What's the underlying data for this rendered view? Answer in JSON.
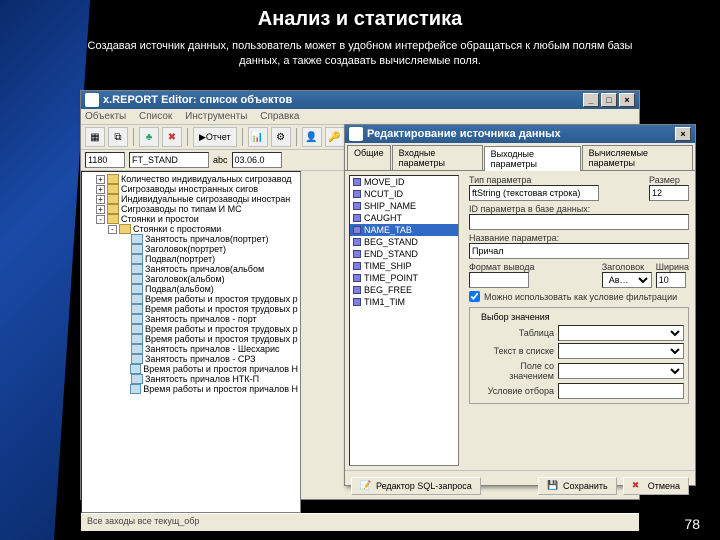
{
  "slide": {
    "title": "Анализ и статистика",
    "subtitle": "Создавая источник данных, пользователь может в удобном интерфейсе обращаться к любым полям базы данных, а также создавать вычисляемые поля.",
    "page_number": "78"
  },
  "editor": {
    "title": "x.REPORT Editor: список объектов",
    "menu": [
      "Объекты",
      "Список",
      "Инструменты",
      "Справка"
    ],
    "toolbar": {
      "report_label": "Отчет"
    },
    "subbar": {
      "code": "1180",
      "table": "FT_STAND",
      "date": "03.06.0"
    },
    "tree": [
      {
        "lvl": 1,
        "tg": "+",
        "icon": "f",
        "label": "Количество индивидуальных сигрозавод"
      },
      {
        "lvl": 1,
        "tg": "+",
        "icon": "f",
        "label": "Сигрозаводы иностранных сигов"
      },
      {
        "lvl": 1,
        "tg": "+",
        "icon": "f",
        "label": "Индивидуальные сигрозаводы иностран"
      },
      {
        "lvl": 1,
        "tg": "+",
        "icon": "f",
        "label": "Сигрозаводы по типам И МС"
      },
      {
        "lvl": 1,
        "tg": "-",
        "icon": "f",
        "label": "Стоянки и простои"
      },
      {
        "lvl": 2,
        "tg": "-",
        "icon": "f",
        "label": "Стоянки с простоями"
      },
      {
        "lvl": 3,
        "tg": "",
        "icon": "g",
        "label": "Занятость причалов(портрет)"
      },
      {
        "lvl": 3,
        "tg": "",
        "icon": "g",
        "label": "Заголовок(портрет)"
      },
      {
        "lvl": 3,
        "tg": "",
        "icon": "g",
        "label": "Подвал(портрет)"
      },
      {
        "lvl": 3,
        "tg": "",
        "icon": "g",
        "label": "Занятость причалов(альбом"
      },
      {
        "lvl": 3,
        "tg": "",
        "icon": "g",
        "label": "Заголовок(альбом)"
      },
      {
        "lvl": 3,
        "tg": "",
        "icon": "g",
        "label": "Подвал(альбом)"
      },
      {
        "lvl": 3,
        "tg": "",
        "icon": "g",
        "label": "Время работы и простоя трудовых р"
      },
      {
        "lvl": 3,
        "tg": "",
        "icon": "g",
        "label": "Время работы и простоя трудовых р"
      },
      {
        "lvl": 3,
        "tg": "",
        "icon": "g",
        "label": "Занятость причалов - порт"
      },
      {
        "lvl": 3,
        "tg": "",
        "icon": "g",
        "label": "Время работы и простоя трудовых р"
      },
      {
        "lvl": 3,
        "tg": "",
        "icon": "g",
        "label": "Время работы и простоя трудовых р"
      },
      {
        "lvl": 3,
        "tg": "",
        "icon": "g",
        "label": "Занятость причалов - Шесхарис"
      },
      {
        "lvl": 3,
        "tg": "",
        "icon": "g",
        "label": "Занятость причалов - СРЗ"
      },
      {
        "lvl": 3,
        "tg": "",
        "icon": "g",
        "label": "Время работы и простоя причалов Н"
      },
      {
        "lvl": 3,
        "tg": "",
        "icon": "g",
        "label": "Занятость причалов НТК-П"
      },
      {
        "lvl": 3,
        "tg": "",
        "icon": "g",
        "label": "Время работы и простоя причалов Н"
      }
    ],
    "statusbar": "Все заходы все текущ_обр"
  },
  "dialog": {
    "title": "Редактирование источника данных",
    "tabs": [
      "Общие",
      "Входные параметры",
      "Выходные параметры",
      "Вычисляемые параметры"
    ],
    "active_tab": 2,
    "list": [
      "MOVE_ID",
      "NCUT_ID",
      "SHIP_NAME",
      "CAUGHT",
      "NAME_TAB",
      "BEG_STAND",
      "END_STAND",
      "TIME_SHIP",
      "TIME_POINT",
      "BEG_FREE",
      "TIM1_TIM"
    ],
    "selected_index": 4,
    "form": {
      "type_label": "Тип параметра",
      "type_value": "ftString (текстовая строка)",
      "size_label": "Размер",
      "size_value": "12",
      "id_label": "ID параметра в базе данных:",
      "id_value": "",
      "name_label": "Название параметра:",
      "name_value": "Причал",
      "format_label": "Формат вывода",
      "header_label": "Заголовок",
      "header_value": "Ав…",
      "width_label": "Ширина",
      "width_value": "10",
      "filter_chk": "Можно использовать как условие фильтрации",
      "select_legend": "Выбор значения",
      "table_label": "Таблица",
      "text_label": "Текст в списке",
      "send_label": "Поле со значением",
      "return_label": "Условие отбора"
    },
    "buttons": {
      "sql": "Редактор SQL-запроса",
      "save": "Сохранить",
      "cancel": "Отмена"
    }
  },
  "icons": {
    "sql": "📝",
    "save": "💾",
    "cancel": "✖"
  }
}
